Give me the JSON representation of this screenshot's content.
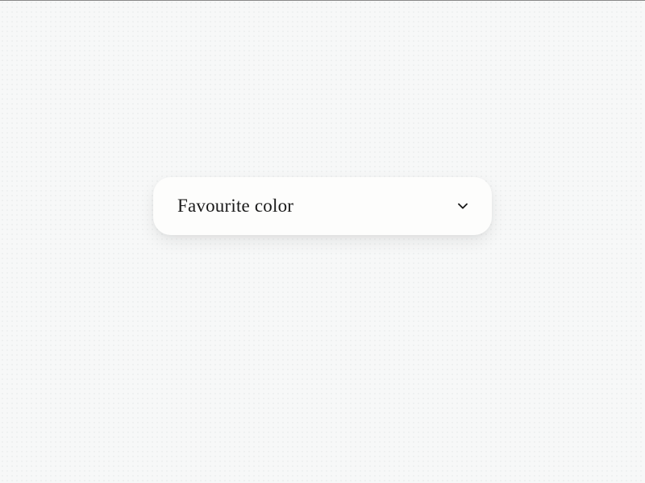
{
  "dropdown": {
    "label": "Favourite color"
  }
}
